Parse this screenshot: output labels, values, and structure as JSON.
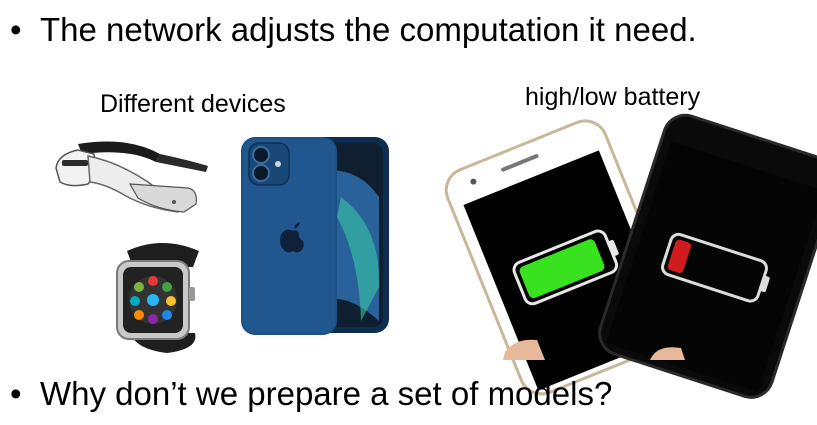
{
  "bullets": [
    {
      "marker": "•",
      "text": "The network adjusts the computation it need."
    },
    {
      "marker": "•",
      "text": "Why don’t we prepare a set of models?"
    }
  ],
  "captions": {
    "devices": "Different devices",
    "battery": "high/low battery"
  },
  "images": {
    "glasses": "smart-glasses",
    "watch": "smartwatch",
    "phone": "blue-smartphone",
    "battery_phones": "two-phones-battery-levels"
  },
  "battery_levels": {
    "high": 0.92,
    "low": 0.18
  },
  "colors": {
    "phone_blue": "#1c4f83",
    "battery_full": "#39e21f",
    "battery_low": "#d01c1c"
  }
}
